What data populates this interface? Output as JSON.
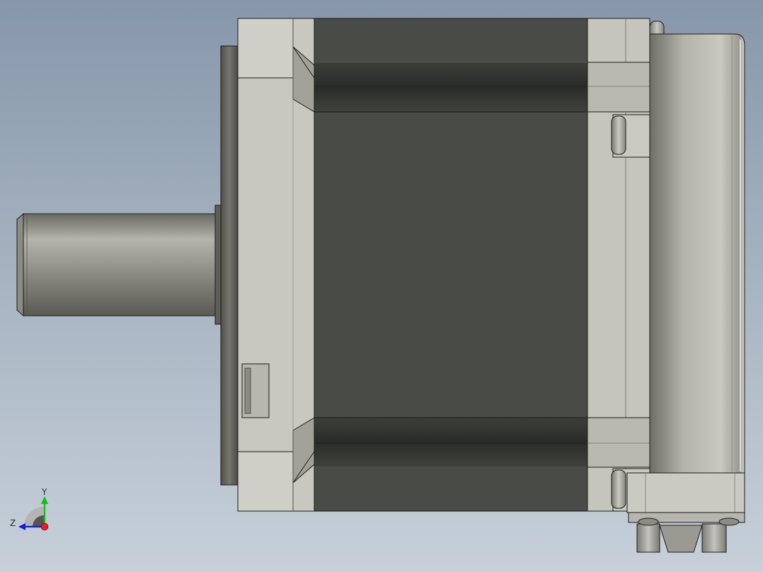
{
  "viewport": {
    "background_top": "#8a9aac",
    "background_bottom": "#c6cfd8"
  },
  "triad": {
    "y_label": "Y",
    "z_label": "Z",
    "y_color": "#10c010",
    "z_color": "#1020e0",
    "x_color": "#e02020"
  },
  "colors": {
    "body_dark": "#494b46",
    "housing_light": "#c5c5bd",
    "metal_mid": "#a6a69e",
    "outline": "#1a1a1a"
  }
}
